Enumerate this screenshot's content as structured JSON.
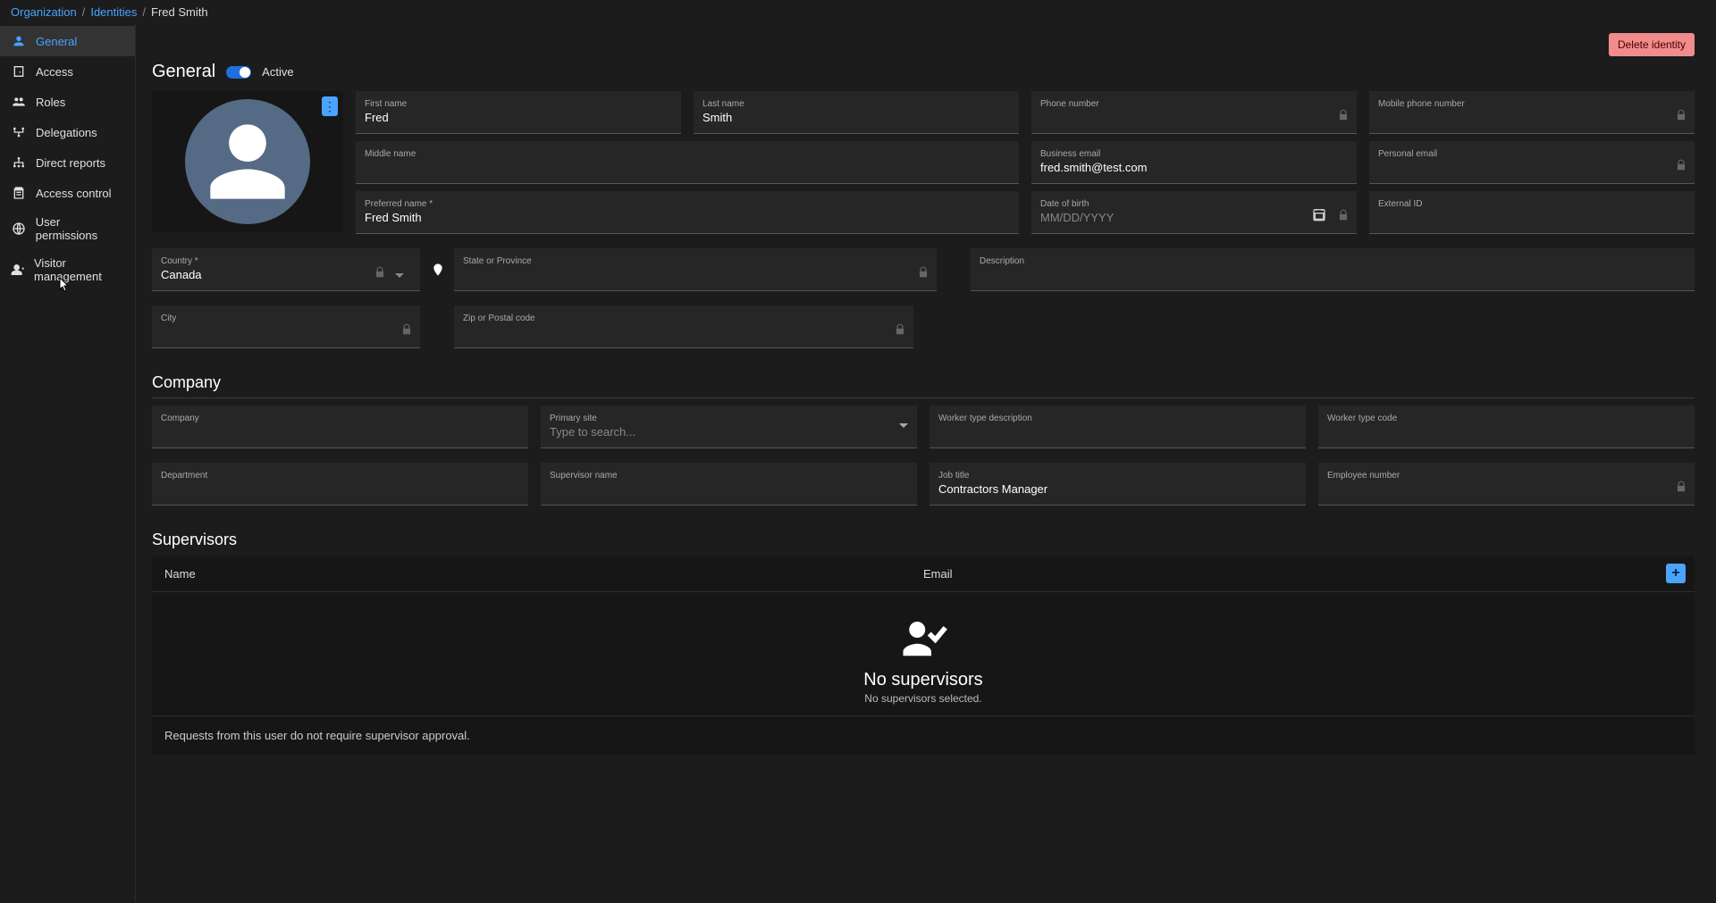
{
  "breadcrumb": {
    "org": "Organization",
    "identities": "Identities",
    "current": "Fred Smith"
  },
  "sidebar": {
    "items": [
      {
        "label": "General"
      },
      {
        "label": "Access"
      },
      {
        "label": "Roles"
      },
      {
        "label": "Delegations"
      },
      {
        "label": "Direct reports"
      },
      {
        "label": "Access control"
      },
      {
        "label": "User permissions"
      },
      {
        "label": "Visitor management"
      }
    ]
  },
  "header": {
    "delete": "Delete identity"
  },
  "general": {
    "title": "General",
    "active_label": "Active",
    "first_name_label": "First name",
    "first_name": "Fred",
    "last_name_label": "Last name",
    "last_name": "Smith",
    "phone_label": "Phone number",
    "phone": "",
    "mobile_label": "Mobile phone number",
    "mobile": "",
    "middle_label": "Middle name",
    "middle": "",
    "biz_email_label": "Business email",
    "biz_email": "fred.smith@test.com",
    "pers_email_label": "Personal email",
    "pers_email": "",
    "pref_name_label": "Preferred name *",
    "pref_name": "Fred Smith",
    "dob_label": "Date of birth",
    "dob_placeholder": "MM/DD/YYYY",
    "ext_id_label": "External ID",
    "ext_id": "",
    "country_label": "Country *",
    "country": "Canada",
    "state_label": "State or Province",
    "state": "",
    "desc_label": "Description",
    "desc": "",
    "city_label": "City",
    "city": "",
    "zip_label": "Zip or Postal code",
    "zip": ""
  },
  "company": {
    "title": "Company",
    "company_label": "Company",
    "company": "",
    "site_label": "Primary site",
    "site_placeholder": "Type to search...",
    "wtd_label": "Worker type description",
    "wtd": "",
    "wtc_label": "Worker type code",
    "wtc": "",
    "dept_label": "Department",
    "dept": "",
    "supname_label": "Supervisor name",
    "supname": "",
    "job_label": "Job title",
    "job": "Contractors Manager",
    "emp_label": "Employee number",
    "emp": ""
  },
  "supervisors": {
    "title": "Supervisors",
    "col_name": "Name",
    "col_email": "Email",
    "empty_title": "No supervisors",
    "empty_sub": "No supervisors selected.",
    "footer": "Requests from this user do not require supervisor approval."
  }
}
